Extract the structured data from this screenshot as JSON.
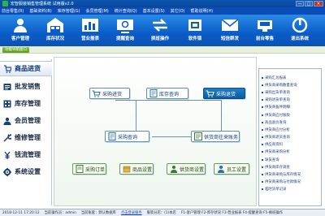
{
  "window": {
    "title": "宏智服装销售管理系统 试用版v2.0",
    "min_label": "—",
    "max_label": "□",
    "close_label": "✕"
  },
  "menu": [
    "前台零售(R)",
    "基础资料(B)",
    "库存管理(G)",
    "会员管理(M)",
    "统计查询(Q)",
    "基本设置(S)",
    "其它(O)",
    "帮助说明(H)"
  ],
  "toolbar": [
    {
      "label": "客户管理",
      "icon": "customer-icon"
    },
    {
      "label": "库存状况",
      "icon": "warehouse-icon"
    },
    {
      "label": "营业报表",
      "icon": "report-icon"
    },
    {
      "label": "提醒查询",
      "icon": "reminder-icon"
    },
    {
      "label": "换班操作",
      "icon": "shift-icon"
    },
    {
      "label": "软件锁",
      "icon": "lock-icon"
    },
    {
      "label": "短信群发",
      "icon": "sms-icon"
    },
    {
      "label": "前台零售",
      "icon": "retail-icon"
    },
    {
      "label": "退出系统",
      "icon": "exit-icon"
    }
  ],
  "crumb": {
    "label": "功能导航窗口"
  },
  "sidebar": [
    {
      "label": "商品进货",
      "icon": "goods-icon"
    },
    {
      "label": "批发销售",
      "icon": "wholesale-icon"
    },
    {
      "label": "库存管理",
      "icon": "stock-icon"
    },
    {
      "label": "会员管理",
      "icon": "member-icon"
    },
    {
      "label": "维修管理",
      "icon": "repair-icon"
    },
    {
      "label": "钱流管理",
      "icon": "cash-icon"
    },
    {
      "label": "系统设置",
      "icon": "settings-icon"
    }
  ],
  "flow": {
    "purchase_in": "采购进货",
    "stock_query": "库存查询",
    "purchase_return": "采购退货",
    "purchase_query": "采购查询",
    "supplier_account": "供货商往来账务",
    "purchase_order": "采购订单",
    "goods_settings": "商品设置",
    "supplier_settings": "供货商设置",
    "staff_settings": "员工设置"
  },
  "rightpanel": [
    "采购汇总报表",
    "供货商采购数量查询",
    "采购出货单查询",
    "采购进货单查询",
    "供货商备件明细",
    "供货商应付账款",
    "商品底价查询",
    "供货商应付分析",
    "供货商退货查询",
    "供应商资料",
    "供货商采购分析",
    "缺货查询",
    "供货商库存调查",
    "供货商采购与库存情况",
    "供货商采购与付款情况",
    "临时货单记录"
  ],
  "status": {
    "datetime": "2018-12-11 17:20:12",
    "operator": "当前操作员：admin",
    "store": "当前账套：默认数据库",
    "link": "点击登录服务",
    "branch": "服装分店：(1)本店",
    "shortcuts": "F1-客户管理 F2-库存状况 F3-营业报表 F4-提醒查询 F5-换班操作"
  },
  "colors": {
    "titlebar": "#0a4db8",
    "toolbar": "#0a5cc8",
    "accent_green": "#5c9a22",
    "flow_border": "#5d8fb3"
  }
}
